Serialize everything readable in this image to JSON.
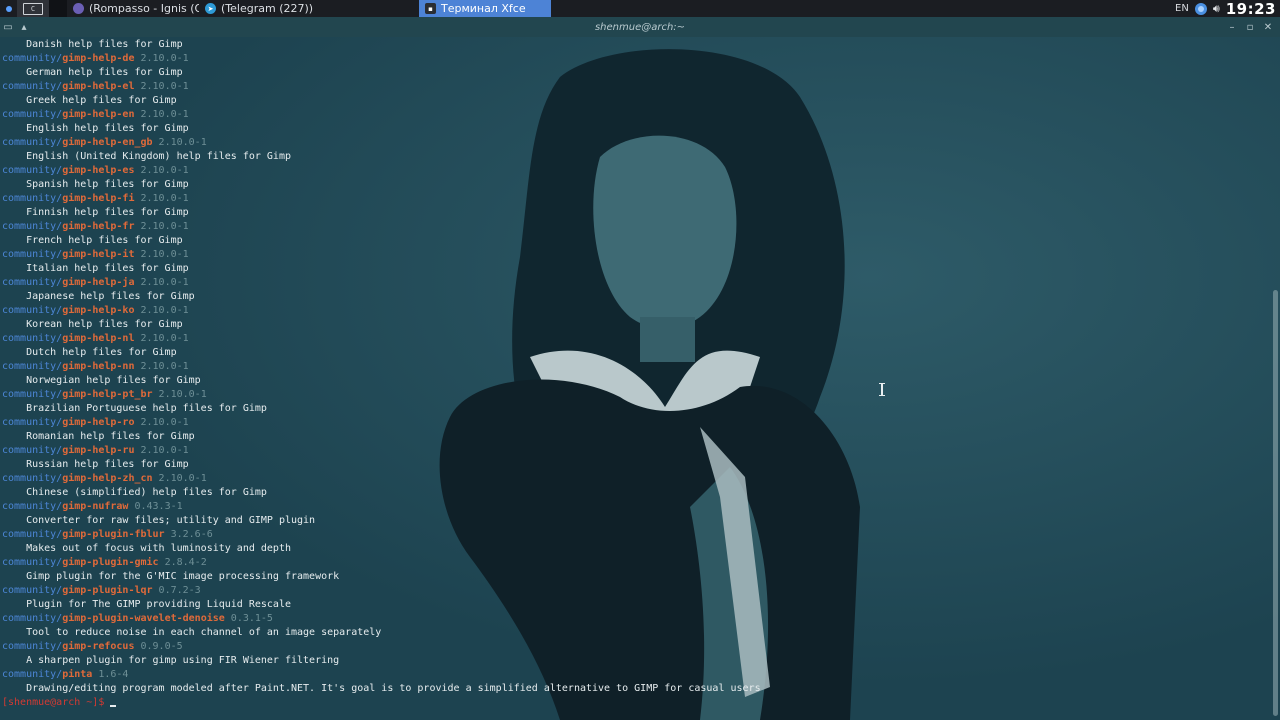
{
  "panel": {
    "desktop_label": "C",
    "tasks": [
      {
        "label": "(Rompasso - Ignis (Offi...",
        "icon": "firefox-icon",
        "active": false
      },
      {
        "label": "(Telegram (227))",
        "icon": "telegram-icon",
        "active": false
      },
      {
        "label": "Терминал Xfce",
        "icon": "terminal-icon",
        "active": true
      }
    ],
    "lang": "EN",
    "clock": "19:23",
    "accent": "#4d83d6"
  },
  "window": {
    "title": "shenmue@arch:~"
  },
  "terminal": {
    "lines": [
      {
        "kind": "desc",
        "text": "    Danish help files for Gimp"
      },
      {
        "kind": "pkg",
        "repo": "community/",
        "name": "gimp-help-de",
        "ver": " 2.10.0-1"
      },
      {
        "kind": "desc",
        "text": "    German help files for Gimp"
      },
      {
        "kind": "pkg",
        "repo": "community/",
        "name": "gimp-help-el",
        "ver": " 2.10.0-1"
      },
      {
        "kind": "desc",
        "text": "    Greek help files for Gimp"
      },
      {
        "kind": "pkg",
        "repo": "community/",
        "name": "gimp-help-en",
        "ver": " 2.10.0-1"
      },
      {
        "kind": "desc",
        "text": "    English help files for Gimp"
      },
      {
        "kind": "pkg",
        "repo": "community/",
        "name": "gimp-help-en_gb",
        "ver": " 2.10.0-1"
      },
      {
        "kind": "desc",
        "text": "    English (United Kingdom) help files for Gimp"
      },
      {
        "kind": "pkg",
        "repo": "community/",
        "name": "gimp-help-es",
        "ver": " 2.10.0-1"
      },
      {
        "kind": "desc",
        "text": "    Spanish help files for Gimp"
      },
      {
        "kind": "pkg",
        "repo": "community/",
        "name": "gimp-help-fi",
        "ver": " 2.10.0-1"
      },
      {
        "kind": "desc",
        "text": "    Finnish help files for Gimp"
      },
      {
        "kind": "pkg",
        "repo": "community/",
        "name": "gimp-help-fr",
        "ver": " 2.10.0-1"
      },
      {
        "kind": "desc",
        "text": "    French help files for Gimp"
      },
      {
        "kind": "pkg",
        "repo": "community/",
        "name": "gimp-help-it",
        "ver": " 2.10.0-1"
      },
      {
        "kind": "desc",
        "text": "    Italian help files for Gimp"
      },
      {
        "kind": "pkg",
        "repo": "community/",
        "name": "gimp-help-ja",
        "ver": " 2.10.0-1"
      },
      {
        "kind": "desc",
        "text": "    Japanese help files for Gimp"
      },
      {
        "kind": "pkg",
        "repo": "community/",
        "name": "gimp-help-ko",
        "ver": " 2.10.0-1"
      },
      {
        "kind": "desc",
        "text": "    Korean help files for Gimp"
      },
      {
        "kind": "pkg",
        "repo": "community/",
        "name": "gimp-help-nl",
        "ver": " 2.10.0-1"
      },
      {
        "kind": "desc",
        "text": "    Dutch help files for Gimp"
      },
      {
        "kind": "pkg",
        "repo": "community/",
        "name": "gimp-help-nn",
        "ver": " 2.10.0-1"
      },
      {
        "kind": "desc",
        "text": "    Norwegian help files for Gimp"
      },
      {
        "kind": "pkg",
        "repo": "community/",
        "name": "gimp-help-pt_br",
        "ver": " 2.10.0-1"
      },
      {
        "kind": "desc",
        "text": "    Brazilian Portuguese help files for Gimp"
      },
      {
        "kind": "pkg",
        "repo": "community/",
        "name": "gimp-help-ro",
        "ver": " 2.10.0-1"
      },
      {
        "kind": "desc",
        "text": "    Romanian help files for Gimp"
      },
      {
        "kind": "pkg",
        "repo": "community/",
        "name": "gimp-help-ru",
        "ver": " 2.10.0-1"
      },
      {
        "kind": "desc",
        "text": "    Russian help files for Gimp"
      },
      {
        "kind": "pkg",
        "repo": "community/",
        "name": "gimp-help-zh_cn",
        "ver": " 2.10.0-1"
      },
      {
        "kind": "desc",
        "text": "    Chinese (simplified) help files for Gimp"
      },
      {
        "kind": "pkg",
        "repo": "community/",
        "name": "gimp-nufraw",
        "ver": " 0.43.3-1"
      },
      {
        "kind": "desc",
        "text": "    Converter for raw files; utility and GIMP plugin"
      },
      {
        "kind": "pkg",
        "repo": "community/",
        "name": "gimp-plugin-fblur",
        "ver": " 3.2.6-6"
      },
      {
        "kind": "desc",
        "text": "    Makes out of focus with luminosity and depth"
      },
      {
        "kind": "pkg",
        "repo": "community/",
        "name": "gimp-plugin-gmic",
        "ver": " 2.8.4-2"
      },
      {
        "kind": "desc",
        "text": "    Gimp plugin for the G'MIC image processing framework"
      },
      {
        "kind": "pkg",
        "repo": "community/",
        "name": "gimp-plugin-lqr",
        "ver": " 0.7.2-3"
      },
      {
        "kind": "desc",
        "text": "    Plugin for The GIMP providing Liquid Rescale"
      },
      {
        "kind": "pkg",
        "repo": "community/",
        "name": "gimp-plugin-wavelet-denoise",
        "ver": " 0.3.1-5"
      },
      {
        "kind": "desc",
        "text": "    Tool to reduce noise in each channel of an image separately"
      },
      {
        "kind": "pkg",
        "repo": "community/",
        "name": "gimp-refocus",
        "ver": " 0.9.0-5"
      },
      {
        "kind": "desc",
        "text": "    A sharpen plugin for gimp using FIR Wiener filtering"
      },
      {
        "kind": "pkg",
        "repo": "community/",
        "name": "pinta",
        "ver": " 1.6-4"
      },
      {
        "kind": "desc",
        "text": "    Drawing/editing program modeled after Paint.NET. It's goal is to provide a simplified alternative to GIMP for casual users"
      }
    ],
    "prompt": "[shenmue@arch ~]$ ",
    "colors": {
      "repo": "#4c86d6",
      "package": "#e06a3a",
      "version": "#6e8f96",
      "prompt": "#d33a33"
    }
  }
}
